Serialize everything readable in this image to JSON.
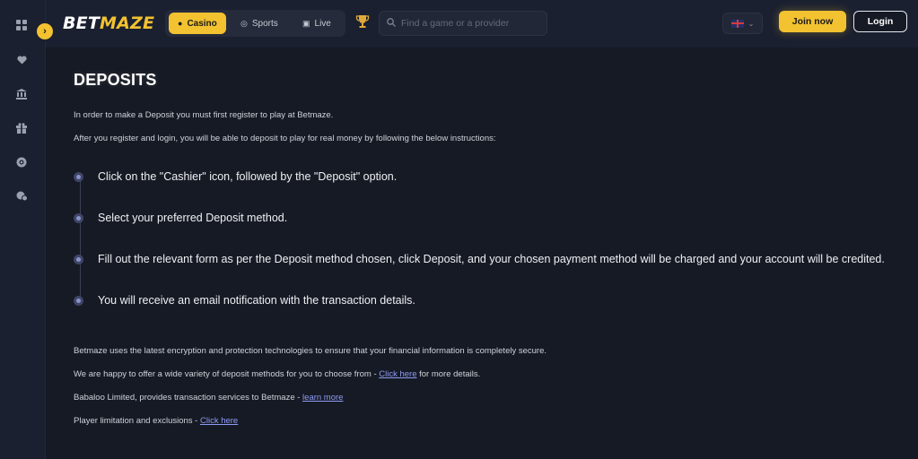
{
  "brand": {
    "part1": "BET",
    "part2": "MAZE"
  },
  "nav": {
    "tabs": [
      {
        "label": "Casino",
        "icon": "casino-chip-icon",
        "active": true
      },
      {
        "label": "Sports",
        "icon": "ball-icon",
        "active": false
      },
      {
        "label": "Live",
        "icon": "live-tv-icon",
        "active": false
      }
    ]
  },
  "search": {
    "placeholder": "Find a game or a provider",
    "value": ""
  },
  "header": {
    "language": "en-GB",
    "join_label": "Join now",
    "login_label": "Login"
  },
  "sidebar": {
    "icons": [
      "grid-icon",
      "heart-icon",
      "bank-icon",
      "gift-icon",
      "chip-icon",
      "chat-icon"
    ]
  },
  "page": {
    "title": "DEPOSITS",
    "intro1": "In order to make a Deposit you must first register to play at Betmaze.",
    "intro2": "After you register and login, you will be able to deposit to play for real money by following the below instructions:",
    "steps": [
      "Click on the \"Cashier\" icon, followed by the \"Deposit\" option.",
      "Select your preferred Deposit method.",
      "Fill out the relevant form as per the Deposit method chosen, click Deposit, and your chosen payment method will be charged and your account will be credited.",
      "You will receive an email notification with the transaction details."
    ],
    "security": "Betmaze uses the latest encryption and protection technologies to ensure that your financial information is completely secure.",
    "methods_prefix": "We are happy to offer a wide variety of deposit methods for you to choose from - ",
    "methods_link": "Click here",
    "methods_suffix": " for more details.",
    "babaloo_prefix": "Babaloo Limited, provides transaction services to Betmaze - ",
    "babaloo_link": "learn more",
    "limits_prefix": "Player limitation and exclusions - ",
    "limits_link": "Click here"
  },
  "colors": {
    "accent": "#f2c230",
    "background": "#161a24",
    "link": "#8e9bf5"
  }
}
